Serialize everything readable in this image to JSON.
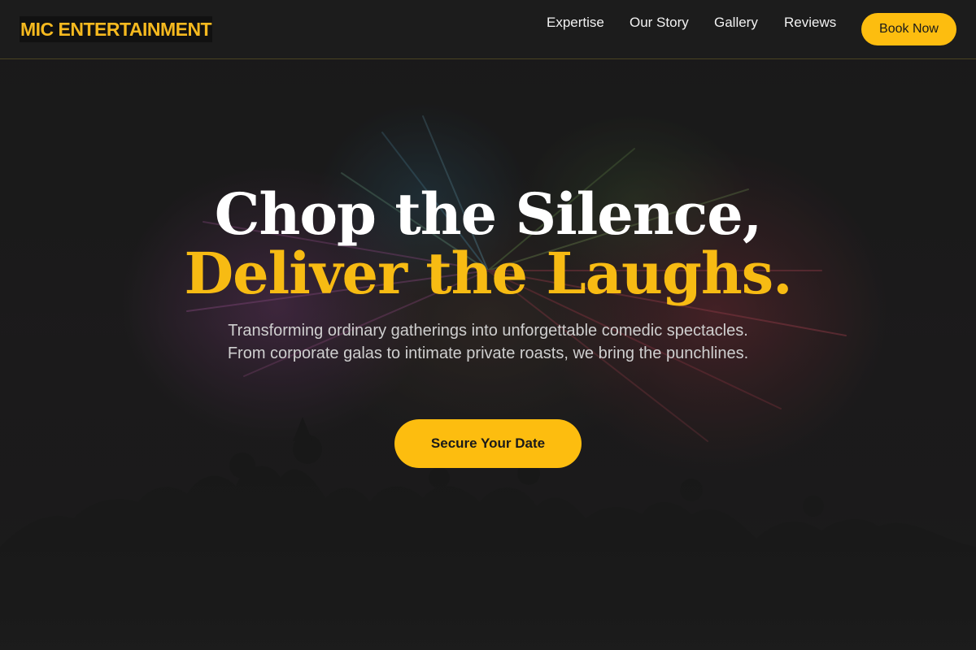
{
  "header": {
    "logo": "MIC ENTERTAINMENT",
    "nav": [
      "Expertise",
      "Our Story",
      "Gallery",
      "Reviews"
    ],
    "book_label": "Book Now"
  },
  "hero": {
    "headline_line1": "Chop the Silence,",
    "headline_line2": "Deliver the Laughs.",
    "subtitle": "Transforming ordinary gatherings into unforgettable comedic spectacles. From corporate galas to intimate private roasts, we bring the punchlines.",
    "cta_label": "Secure Your Date",
    "background_image": "fireworks-crowd-silhouette"
  },
  "colors": {
    "accent": "#fdbd0f",
    "headline_accent": "#f7bb13",
    "header_bg": "#1c1c1c",
    "hero_bg": "#1d1d1d",
    "text": "#ffffff",
    "subtitle": "#cfcfcf"
  }
}
